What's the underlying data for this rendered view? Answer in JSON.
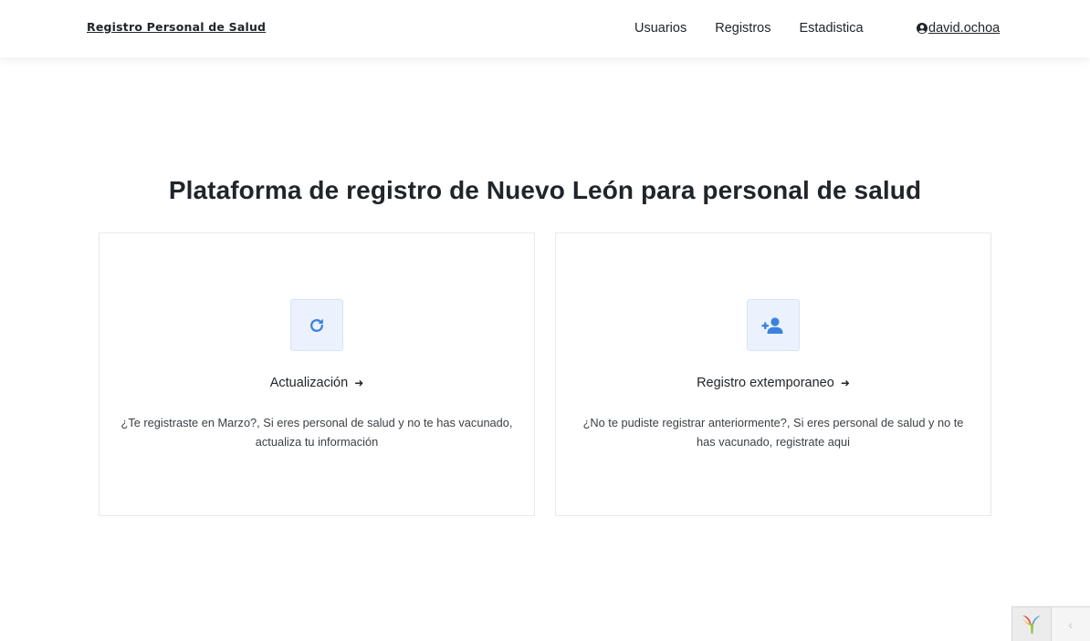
{
  "navbar": {
    "brand": "Registro Personal de Salud",
    "links": [
      "Usuarios",
      "Registros",
      "Estadistica"
    ],
    "user": "david.ochoa"
  },
  "main": {
    "title": "Plataforma de registro de Nuevo León para personal de salud",
    "cards": [
      {
        "icon": "refresh-icon",
        "title": "Actualización",
        "arrow": "➜",
        "description": "¿Te registraste en Marzo?, Si eres personal de salud y no te has vacunado, actualiza tu información"
      },
      {
        "icon": "user-plus-icon",
        "title": "Registro extemporaneo",
        "arrow": "➜",
        "description": "¿No te pudiste registrar anteriormente?, Si eres personal de salud y no te has vacunado, registrate aqui"
      }
    ]
  },
  "debug_toolbar": {
    "toggle_glyph": "‹"
  },
  "colors": {
    "accent": "#3b82e0",
    "icon_bg": "#ebf2fd",
    "text": "#212529"
  }
}
